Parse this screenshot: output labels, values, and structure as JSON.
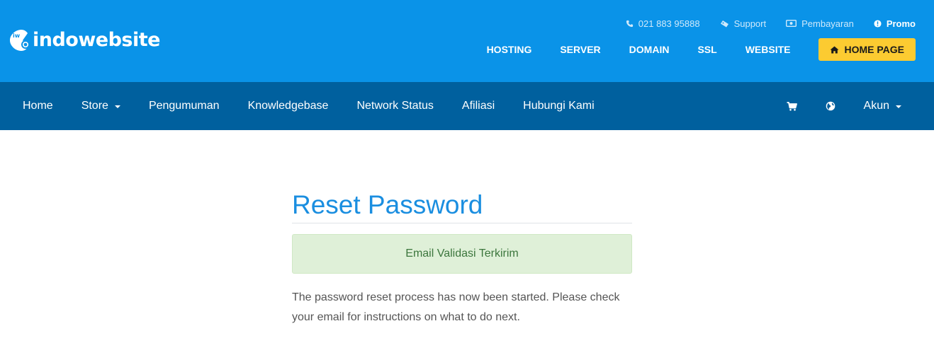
{
  "brand": {
    "logo_text": "indowebsite",
    "logo_badge": "iw"
  },
  "top_links": {
    "phone": "021 883 95888",
    "support": "Support",
    "payment": "Pembayaran",
    "promo": "Promo"
  },
  "main_menu": {
    "hosting": "HOSTING",
    "server": "SERVER",
    "domain": "DOMAIN",
    "ssl": "SSL",
    "website": "WEBSITE",
    "home_page": "HOME PAGE"
  },
  "sub_nav": {
    "items": [
      "Home",
      "Store",
      "Pengumuman",
      "Knowledgebase",
      "Network Status",
      "Afiliasi",
      "Hubungi Kami"
    ],
    "account": "Akun"
  },
  "content": {
    "title": "Reset Password",
    "alert": "Email Validasi Terkirim",
    "message": "The password reset process has now been started. Please check your email for instructions on what to do next."
  },
  "colors": {
    "header_bg": "#0a93e8",
    "subnav_bg": "#00609e",
    "button_accent": "#fccb31",
    "title_color": "#1a8ee0",
    "alert_bg": "#dff0d8",
    "alert_text": "#3c763d"
  },
  "icons": {
    "phone": "phone-icon",
    "support": "ticket-icon",
    "payment": "money-icon",
    "promo": "exclamation-circle-icon",
    "home": "home-icon",
    "cart": "cart-icon",
    "language": "globe-icon"
  }
}
